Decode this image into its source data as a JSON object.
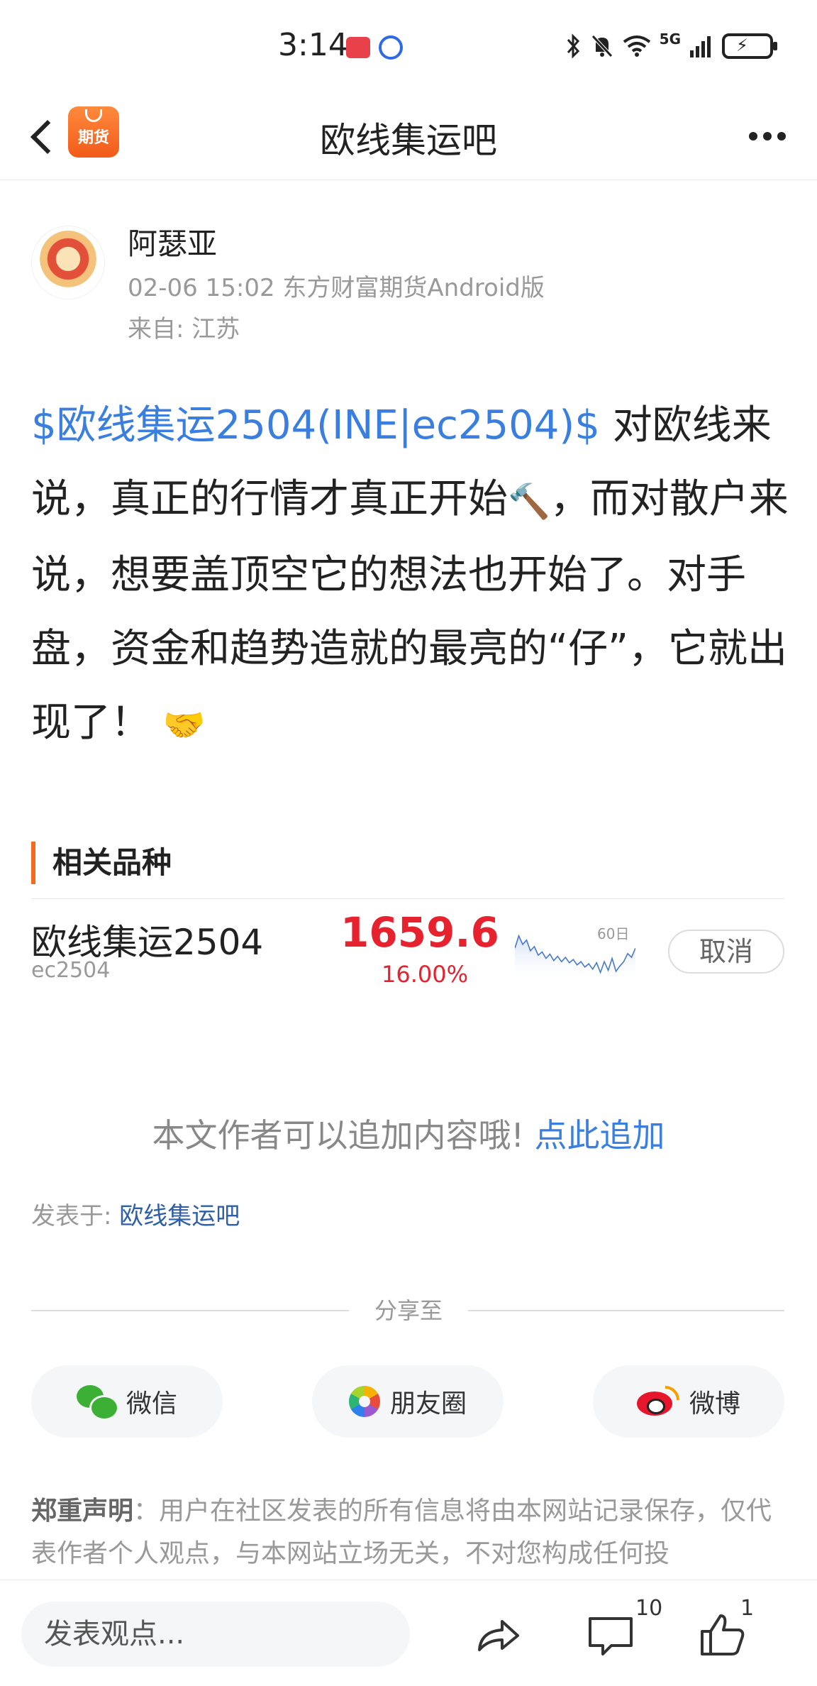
{
  "status_bar": {
    "time": "3:14",
    "network": "5G",
    "icons": [
      "huawei-app-icon",
      "browser-app-icon",
      "bluetooth-icon",
      "mute-icon",
      "wifi-icon",
      "signal-icon",
      "battery-charging-icon"
    ]
  },
  "nav": {
    "logo_text": "期货",
    "title": "欧线集运吧",
    "back_icon": "back-chevron-icon",
    "more_icon": "more-dots-icon"
  },
  "post": {
    "author": "阿瑟亚",
    "meta": "02-06 15:02 东方财富期货Android版",
    "location": "来自: 江苏",
    "tag": "$欧线集运2504(INE|ec2504)$",
    "body_1": " 对欧线来说，真正的行情才真正开始",
    "emoji_gavel": "🔨",
    "body_2": "，而对散户来说，想要盖顶空它的想法也开始了。对手盘，资金和趋势造就的最亮的“仔”，它就出现了！",
    "emoji_handshake": "🤝"
  },
  "related": {
    "heading": "相关品种",
    "items": [
      {
        "name": "欧线集运2504",
        "code": "ec2504",
        "price": "1659.6",
        "change_pct": "16.00%",
        "chart_label": "60日",
        "action": "取消"
      }
    ],
    "sparkline": [
      0.55,
      0.78,
      0.62,
      0.7,
      0.5,
      0.58,
      0.42,
      0.48,
      0.36,
      0.44,
      0.32,
      0.4,
      0.3,
      0.38,
      0.28,
      0.34,
      0.24,
      0.3,
      0.2,
      0.26,
      0.16,
      0.28,
      0.1,
      0.3,
      0.14,
      0.36,
      0.12,
      0.22,
      0.3,
      0.45,
      0.38,
      0.55
    ]
  },
  "add_content": {
    "prompt": "本文作者可以追加内容哦!",
    "link": "点此追加"
  },
  "posted_in": {
    "label": "发表于: ",
    "bar": "欧线集运吧"
  },
  "share": {
    "title": "分享至",
    "buttons": [
      {
        "label": "微信",
        "icon": "wechat-icon"
      },
      {
        "label": "朋友圈",
        "icon": "moments-icon"
      },
      {
        "label": "微博",
        "icon": "weibo-icon"
      }
    ]
  },
  "disclaimer": {
    "label": "郑重声明",
    "text": "：用户在社区发表的所有信息将由本网站记录保存，仅代表作者个人观点，与本网站立场无关，不对您构成任何投"
  },
  "bottom_bar": {
    "placeholder": "发表观点...",
    "comment_count": "10",
    "like_count": "1"
  },
  "colors": {
    "accent_blue": "#3a7fe0",
    "price_red": "#e5222d",
    "brand_orange": "#f26b21"
  }
}
